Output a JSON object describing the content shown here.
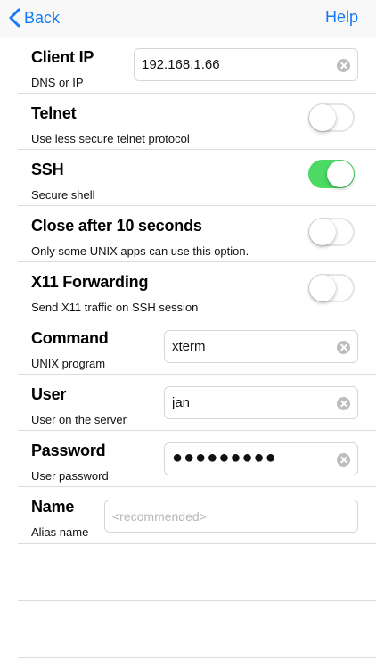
{
  "nav": {
    "back_label": "Back",
    "help_label": "Help"
  },
  "colors": {
    "accent": "#1479fb",
    "toggle_on": "#4cd964"
  },
  "rows": {
    "client_ip": {
      "title": "Client IP",
      "subtitle": "DNS or IP",
      "value": "192.168.1.66"
    },
    "telnet": {
      "title": "Telnet",
      "subtitle": "Use less secure telnet protocol",
      "enabled": false
    },
    "ssh": {
      "title": "SSH",
      "subtitle": "Secure shell",
      "enabled": true
    },
    "close_after": {
      "title": "Close after 10 seconds",
      "subtitle": "Only some UNIX apps can use this option.",
      "enabled": false
    },
    "x11": {
      "title": "X11 Forwarding",
      "subtitle": "Send X11 traffic on SSH session",
      "enabled": false
    },
    "command": {
      "title": "Command",
      "subtitle": "UNIX program",
      "value": "xterm"
    },
    "user": {
      "title": "User",
      "subtitle": "User on the server",
      "value": "jan"
    },
    "password": {
      "title": "Password",
      "subtitle": "User password",
      "value": "●●●●●●●●●"
    },
    "name": {
      "title": "Name",
      "subtitle": "Alias name",
      "placeholder": "<recommended>"
    }
  }
}
